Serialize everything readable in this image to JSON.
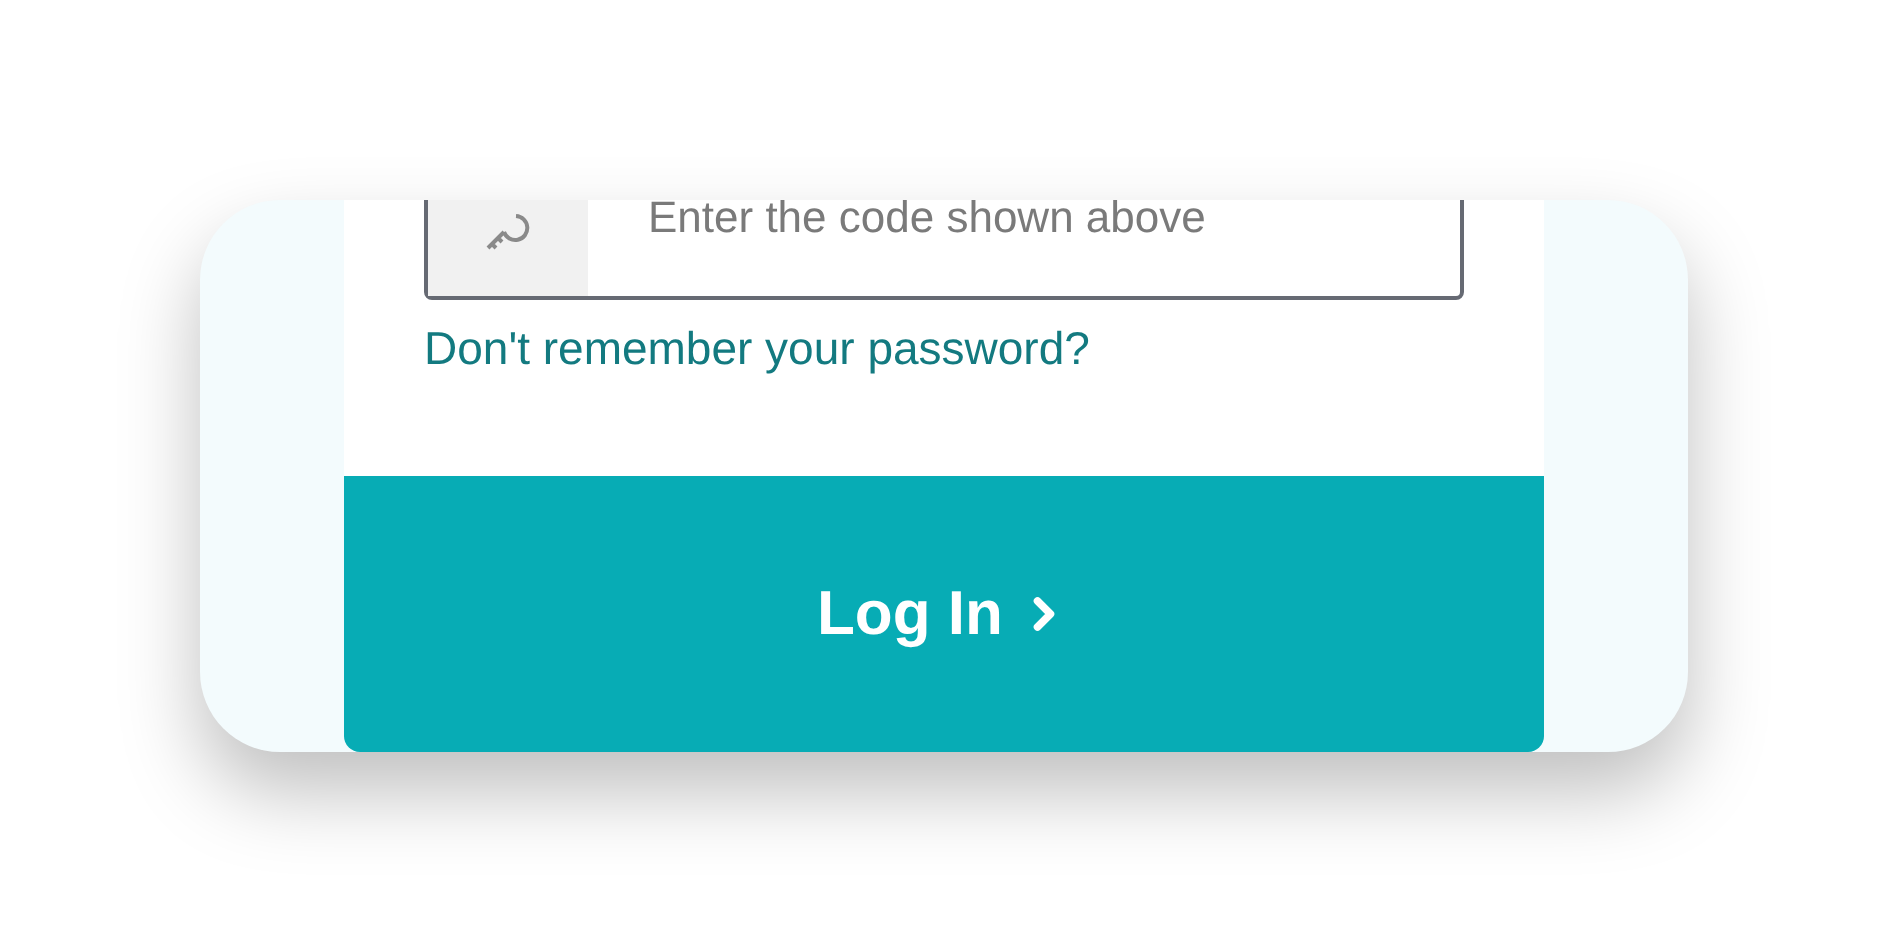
{
  "code_field": {
    "placeholder": "Enter the code shown above"
  },
  "forgot_link": {
    "label": "Don't remember your password?"
  },
  "login_button": {
    "label": "Log In"
  }
}
